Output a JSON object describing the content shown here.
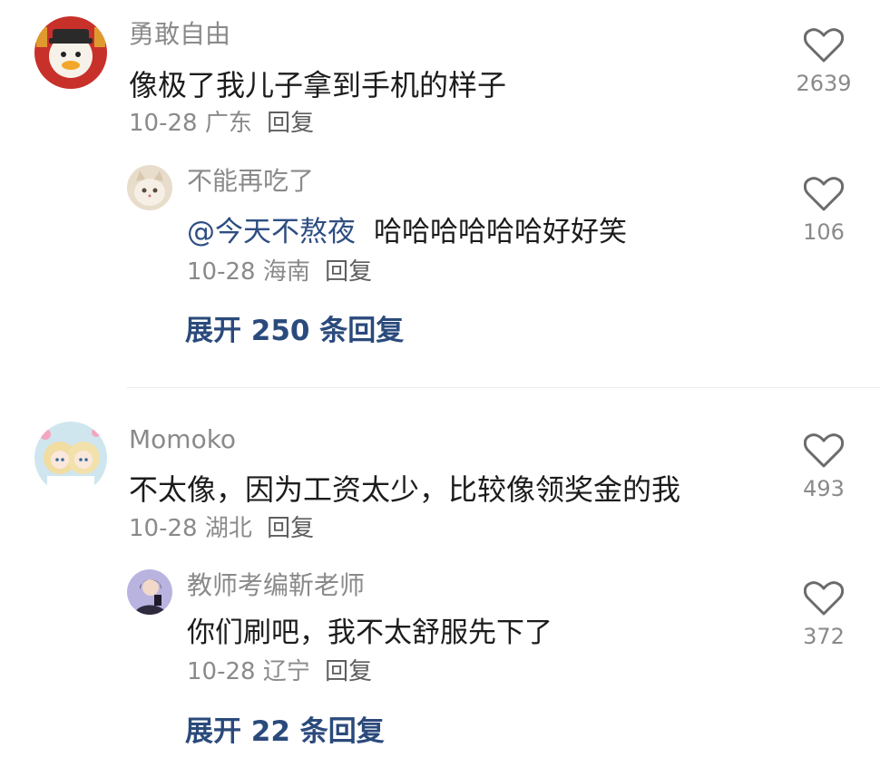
{
  "comments": [
    {
      "username": "勇敢自由",
      "text": "像极了我儿子拿到手机的样子",
      "date": "10-28",
      "location": "广东",
      "reply_label": "回复",
      "likes": "2639",
      "avatar_icon": "cartoon-duck-icon",
      "reply": {
        "username": "不能再吃了",
        "mention": "@今天不熬夜",
        "text": "哈哈哈哈哈哈好好笑",
        "date": "10-28",
        "location": "海南",
        "reply_label": "回复",
        "likes": "106",
        "avatar_icon": "cat-photo-icon"
      },
      "expand_label": "展开 250 条回复"
    },
    {
      "username": "Momoko",
      "text": "不太像，因为工资太少，比较像领奖金的我",
      "date": "10-28",
      "location": "湖北",
      "reply_label": "回复",
      "likes": "493",
      "avatar_icon": "anime-girls-icon",
      "reply": {
        "username": "教师考编靳老师",
        "text": "你们刷吧，我不太舒服先下了",
        "date": "10-28",
        "location": "辽宁",
        "reply_label": "回复",
        "likes": "372",
        "avatar_icon": "person-photo-icon"
      },
      "expand_label": "展开 22 条回复"
    }
  ],
  "colors": {
    "username": "#8a8a8a",
    "text": "#1c1c1c",
    "link": "#2b4a7c",
    "heart": "#6b6b6b"
  }
}
